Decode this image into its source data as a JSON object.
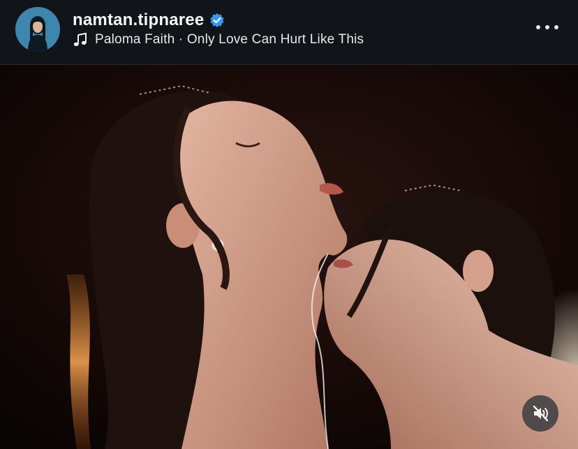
{
  "post_header": {
    "username": "namtan.tipnaree",
    "verified": true,
    "audio_track": "Paloma Faith · Only Love Can Hurt Like This",
    "more_icon": "more-horizontal-icon"
  },
  "media": {
    "type": "video",
    "muted": true,
    "mute_icon": "speaker-muted-icon"
  },
  "colors": {
    "background": "#0f1216",
    "verified_badge": "#3897f0",
    "text": "#f5f5f5"
  }
}
